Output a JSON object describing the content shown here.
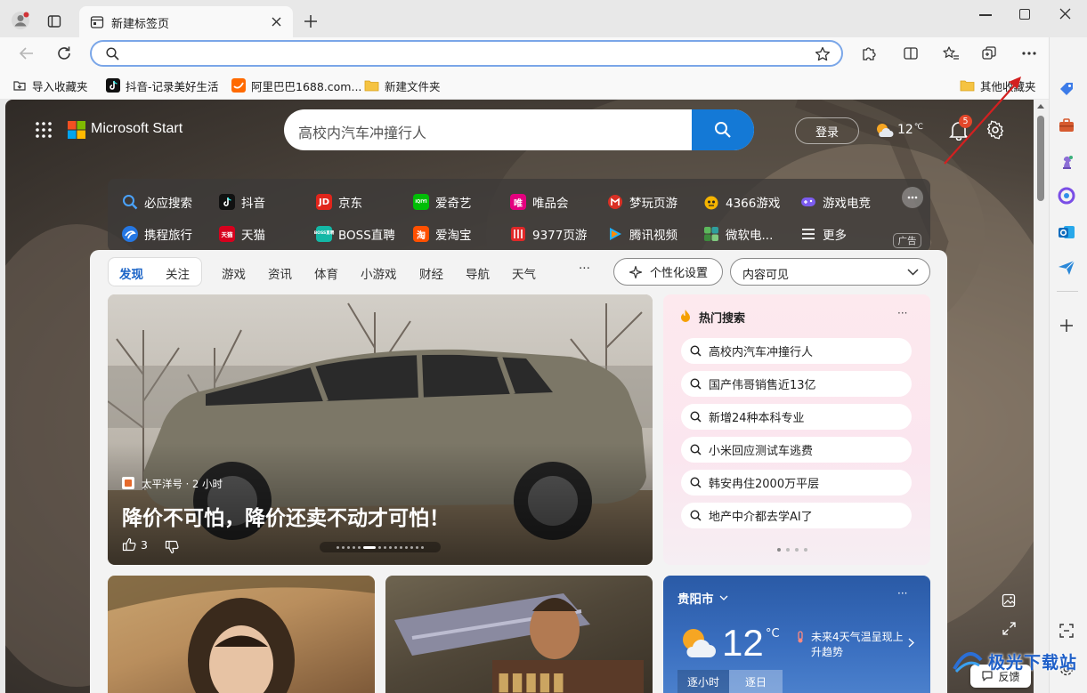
{
  "browser": {
    "tab_title": "新建标签页",
    "address_value": "",
    "bookmarks": [
      {
        "label": "导入收藏夹"
      },
      {
        "label": "抖音-记录美好生活"
      },
      {
        "label": "阿里巴巴1688.com..."
      },
      {
        "label": "新建文件夹"
      }
    ],
    "other_favorites": "其他收藏夹"
  },
  "ms": {
    "brand": "Microsoft Start",
    "search_query": "高校内汽车冲撞行人",
    "login": "登录",
    "temperature": "12",
    "temp_unit": "℃",
    "notification_count": "5"
  },
  "quick_links": {
    "row1": [
      "必应搜索",
      "抖音",
      "京东",
      "爱奇艺",
      "唯品会",
      "梦玩页游",
      "4366游戏",
      "游戏电竞"
    ],
    "row2": [
      "携程旅行",
      "天猫",
      "BOSS直聘",
      "爱淘宝",
      "9377页游",
      "腾讯视频",
      "微软电...",
      "更多"
    ],
    "ad": "广告",
    "icon_text": {
      "jd": "JD",
      "iqiyi": "iQIYI",
      "vip": "唯",
      "tmall": "天猫",
      "boss": "BOSS直聘",
      "taobao": "淘"
    }
  },
  "feed_nav": {
    "active": "发现",
    "follow": "关注",
    "tabs": [
      "游戏",
      "资讯",
      "体育",
      "小游戏",
      "财经",
      "导航",
      "天气"
    ],
    "more": "···",
    "personalize": "个性化设置",
    "visibility": "内容可见"
  },
  "hero": {
    "source": "太平洋号 · 2 小时",
    "title": "降价不可怕，降价还卖不动才可怕！",
    "likes": "3",
    "carousel_count": 15,
    "carousel_active": 5
  },
  "hot_search": {
    "title": "热门搜索",
    "more": "···",
    "items": [
      "高校内汽车冲撞行人",
      "国产伟哥销售近13亿",
      "新增24种本科专业",
      "小米回应测试车逃费",
      "韩安冉住2000万平层",
      "地产中介都去学AI了"
    ]
  },
  "weather": {
    "city": "贵阳市",
    "temp": "12",
    "unit": "°C",
    "alert": "未来4天气温呈现上升趋势",
    "tab_hourly": "逐小时",
    "tab_daily": "逐日",
    "more": "···"
  },
  "feedback": "反馈",
  "watermark": "极光下载站",
  "colors": {
    "accent": "#1479d6",
    "arrow": "#d32020",
    "notify": "#e3472a"
  }
}
